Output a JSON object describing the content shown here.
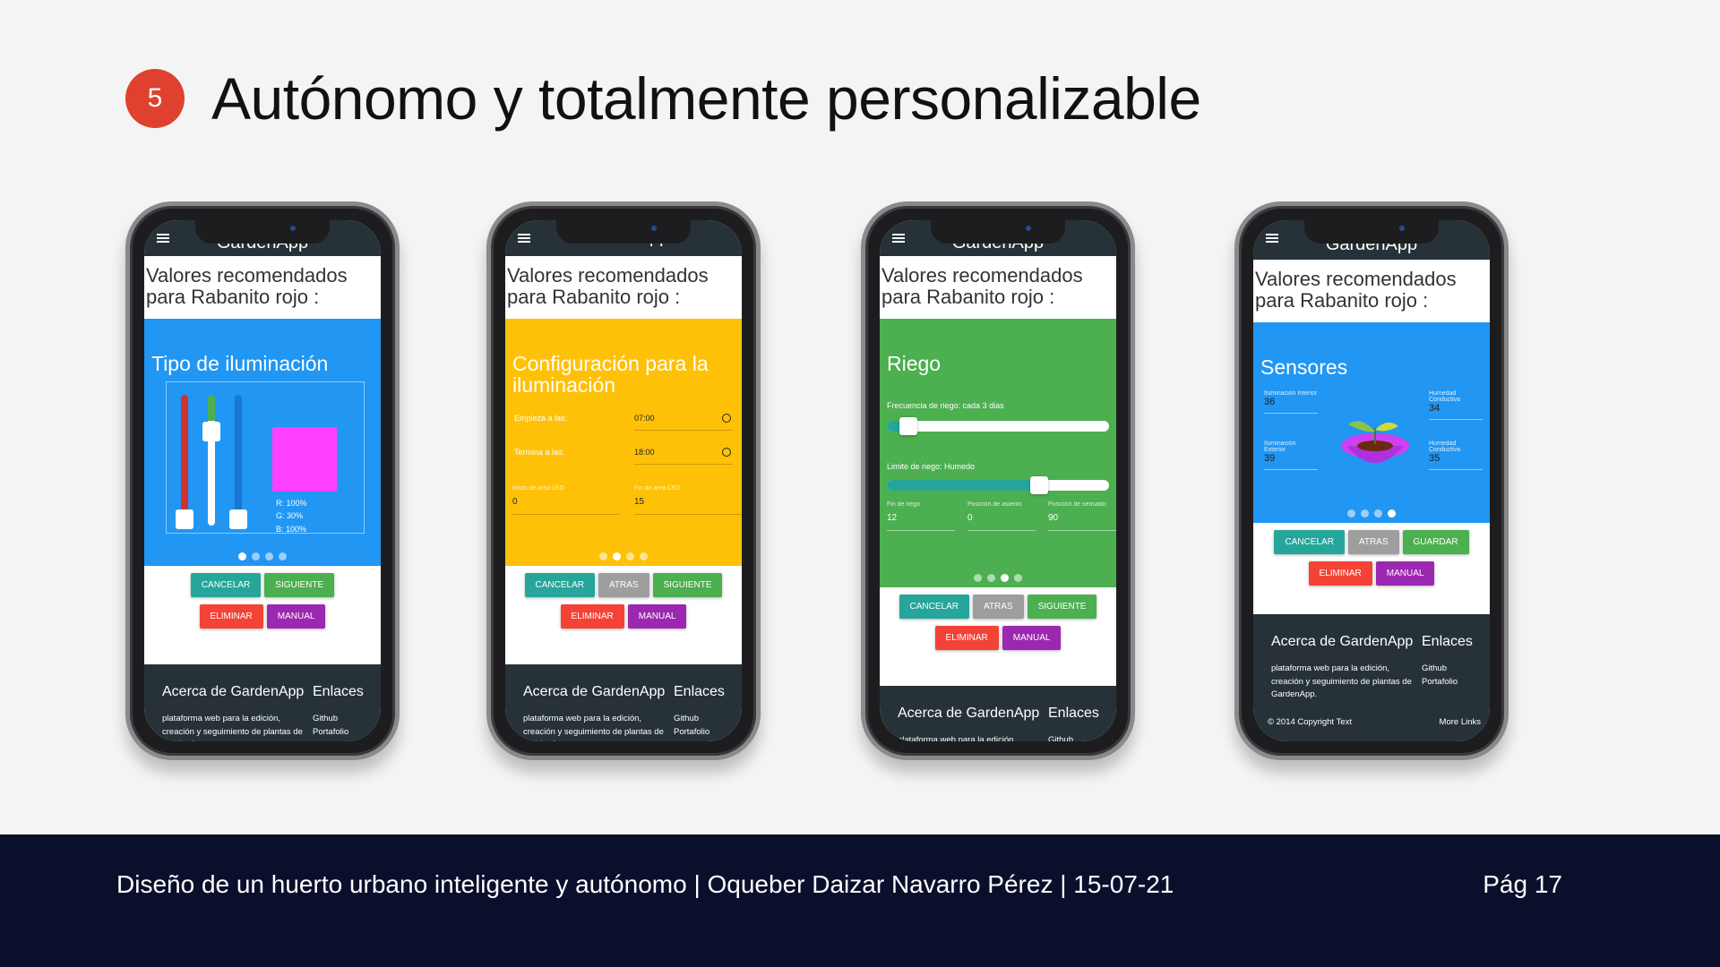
{
  "slide": {
    "number": "5",
    "title": "Autónomo y totalmente personalizable",
    "footer_text": "Diseño de un huerto urbano inteligente y autónomo | Oqueber Daizar Navarro Pérez | 15-07-21",
    "page": "Pág 17"
  },
  "app": {
    "title": "GardenApp",
    "recommendation": "Valores recomendados para Rabanito rojo :",
    "buttons": {
      "cancel": "CANCELAR",
      "next": "SIGUIENTE",
      "back": "ATRAS",
      "save": "GUARDAR",
      "delete": "ELIMINAR",
      "manual": "MANUAL"
    },
    "footer": {
      "about_title": "Acerca de GardenApp",
      "about_text": "plataforma web para la edición, creación y seguimiento de plantas de GardenApp.",
      "links_title": "Enlaces",
      "link1": "Github",
      "link2": "Portafolio",
      "copyright": "© 2014 Copyright Text",
      "more_links": "More Links"
    }
  },
  "screens": {
    "lighting": {
      "title": "Tipo de iluminación",
      "r": "R: 100%",
      "g": "G: 30%",
      "b": "B: 100%",
      "swatch_color": "#ff40ff",
      "slider_levels": {
        "r": 1.0,
        "g": 0.3,
        "b": 1.0
      }
    },
    "config": {
      "title": "Configuración para la iluminación",
      "start_label": "Empieza a las:",
      "start_value": "07:00",
      "end_label": "Termina a las:",
      "end_value": "18:00",
      "led_start_label": "Inicio de area LED",
      "led_start_value": "0",
      "led_end_label": "Fin de area LED",
      "led_end_value": "15"
    },
    "irrigation": {
      "title": "Riego",
      "freq_label": "Frecuencia de riego: cada 3 dias",
      "limit_label": "Limite de riego: Humedo",
      "f1_label": "Fin de riego",
      "f1_value": "12",
      "f2_label": "Posición de asiento",
      "f2_value": "0",
      "f3_label": "Posición de sensado",
      "f3_value": "90"
    },
    "sensors": {
      "title": "Sensores",
      "s1_label": "Iluminación Interior",
      "s1_value": "36",
      "s2_label": "Humedad Conductiva",
      "s2_value": "34",
      "s3_label": "Iluminación Exterior",
      "s3_value": "39",
      "s4_label": "Humedad Conductiva",
      "s4_value": "35"
    }
  },
  "colors": {
    "blue": "#2196f3",
    "amber": "#ffc107",
    "green": "#4caf50",
    "dark": "#263238",
    "badge": "#e0412f",
    "footer_bar": "#0a0f2c"
  }
}
